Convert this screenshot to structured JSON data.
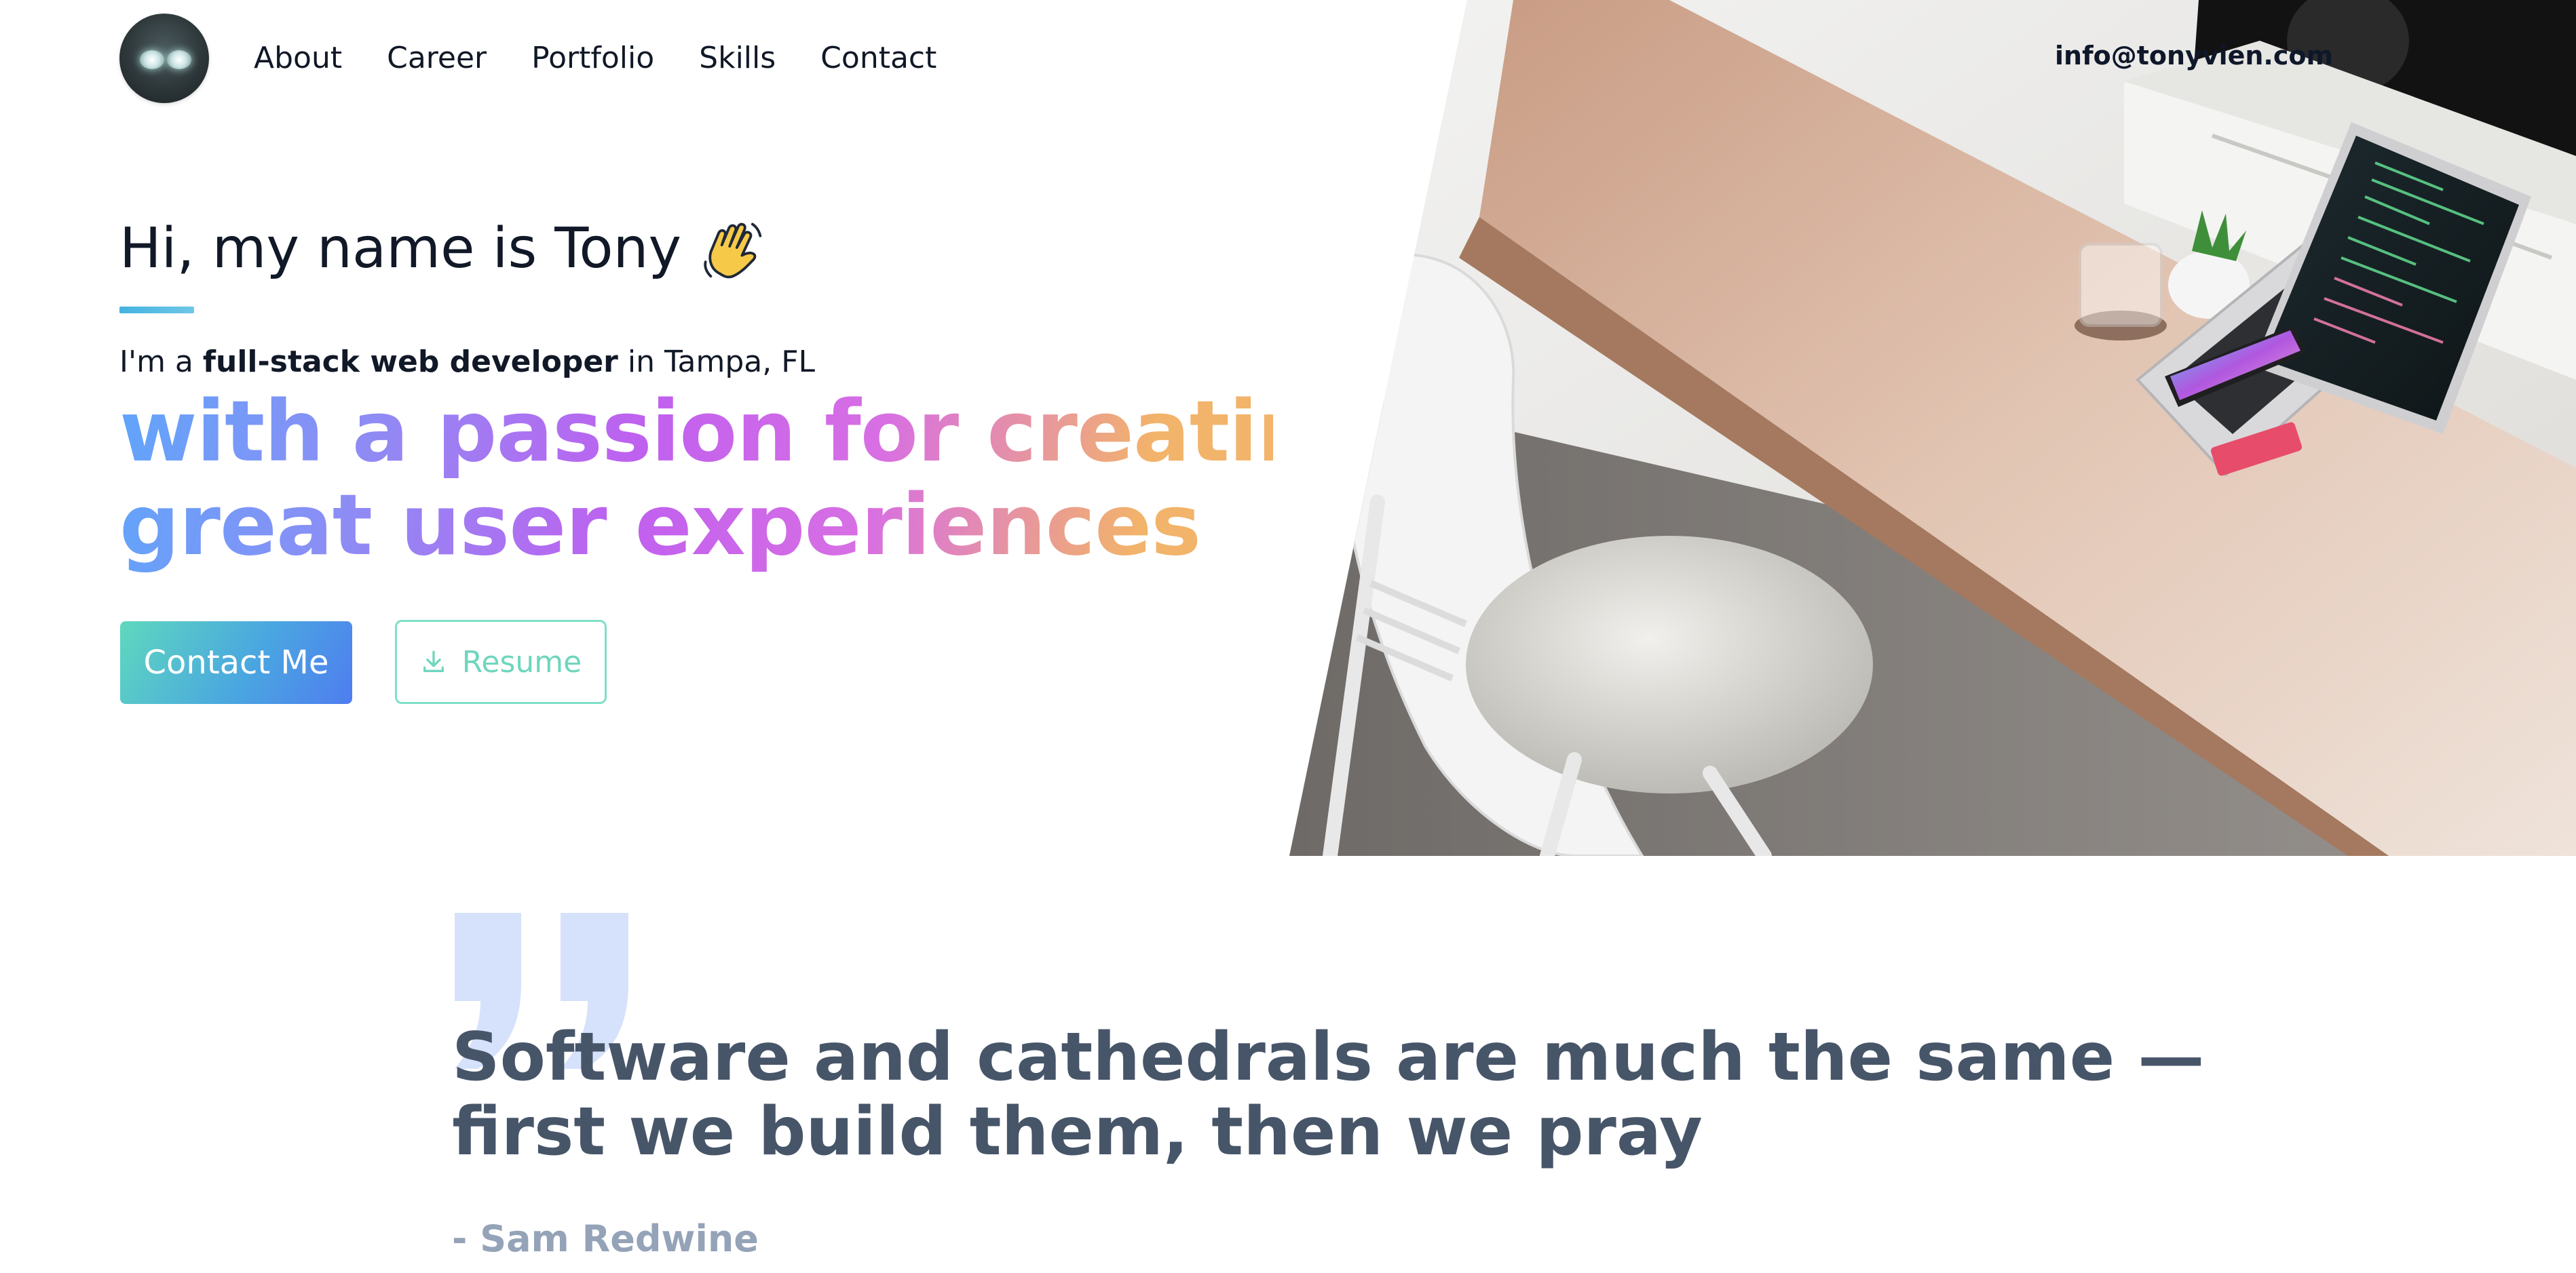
{
  "header": {
    "avatar_alt": "Tony avatar",
    "nav": [
      {
        "label": "About"
      },
      {
        "label": "Career"
      },
      {
        "label": "Portfolio"
      },
      {
        "label": "Skills"
      },
      {
        "label": "Contact"
      }
    ],
    "email": "info@tonyvien.com"
  },
  "hero": {
    "greeting": "Hi, my name is Tony",
    "wave_icon": "waving-hand-icon",
    "intro_prefix": "I'm a ",
    "intro_bold": "full-stack web developer",
    "intro_suffix": " in Tampa, FL",
    "tagline_line1": "with a passion for creating",
    "tagline_line2": "great user experiences",
    "contact_button": "Contact Me",
    "resume_button": "Resume",
    "photo_alt": "Desk with laptop, plant and white chair"
  },
  "quote": {
    "text": "Software and cathedrals are much the same — first we build them, then we pray",
    "author": "- Sam Redwine"
  },
  "colors": {
    "accent_teal": "#6fd6bd",
    "accent_blue": "#4f7df0",
    "gradient_start": "#60a5fa",
    "gradient_mid": "#c060ef",
    "gradient_end": "#f2b36a",
    "quote_mark": "#d6e2fb",
    "quote_text": "#475569",
    "quote_author": "#94a3b8"
  }
}
